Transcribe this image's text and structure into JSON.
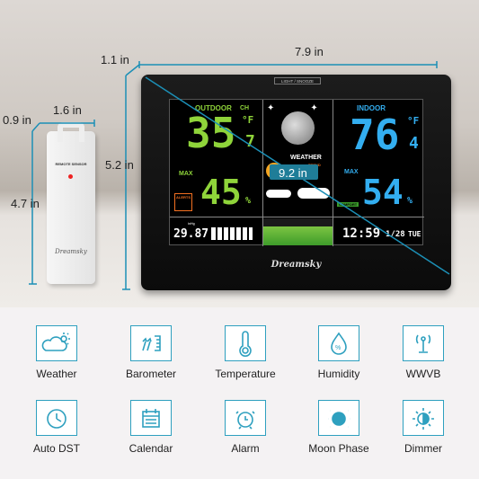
{
  "dimensions": {
    "station_width": "7.9 in",
    "station_depth": "1.1 in",
    "station_height": "5.2 in",
    "screen_diagonal": "9.2 in",
    "sensor_width": "1.6 in",
    "sensor_depth": "0.9 in",
    "sensor_height": "4.7 in"
  },
  "device": {
    "top_button": "LIGHT / SNOOZE",
    "brand": "Dreamsky",
    "outdoor": {
      "label": "OUTDOOR",
      "channel": "CH",
      "temp": "35",
      "temp_decimal": "7",
      "temp_unit": "°F",
      "max_label": "MAX",
      "humidity": "45",
      "humidity_unit": "%",
      "alerts_label": "ALERTS"
    },
    "weather": {
      "label": "WEATHER",
      "trend_label": "TREND"
    },
    "indoor": {
      "label": "INDOOR",
      "temp": "76",
      "temp_decimal": "4",
      "temp_unit": "°F",
      "max_label": "MAX",
      "humidity": "54",
      "humidity_unit": "%",
      "comfort_label": "COMFORT"
    },
    "pressure": {
      "value": "29.87",
      "unit": "inHg"
    },
    "clock": {
      "time": "12:59",
      "date": "1/28",
      "day": "TUE"
    }
  },
  "sensor": {
    "label": "REMOTE SENSOR",
    "brand": "Dreamsky"
  },
  "accent_color": "#2ea0bf",
  "features": [
    {
      "label": "Weather",
      "icon": "weather-icon"
    },
    {
      "label": "Barometer",
      "icon": "barometer-icon"
    },
    {
      "label": "Temperature",
      "icon": "thermometer-icon"
    },
    {
      "label": "Humidity",
      "icon": "humidity-drop-icon"
    },
    {
      "label": "WWVB",
      "icon": "antenna-icon"
    },
    {
      "label": "Auto DST",
      "icon": "clock-icon"
    },
    {
      "label": "Calendar",
      "icon": "calendar-icon"
    },
    {
      "label": "Alarm",
      "icon": "alarm-clock-icon"
    },
    {
      "label": "Moon Phase",
      "icon": "moon-icon"
    },
    {
      "label": "Dimmer",
      "icon": "brightness-icon"
    }
  ]
}
